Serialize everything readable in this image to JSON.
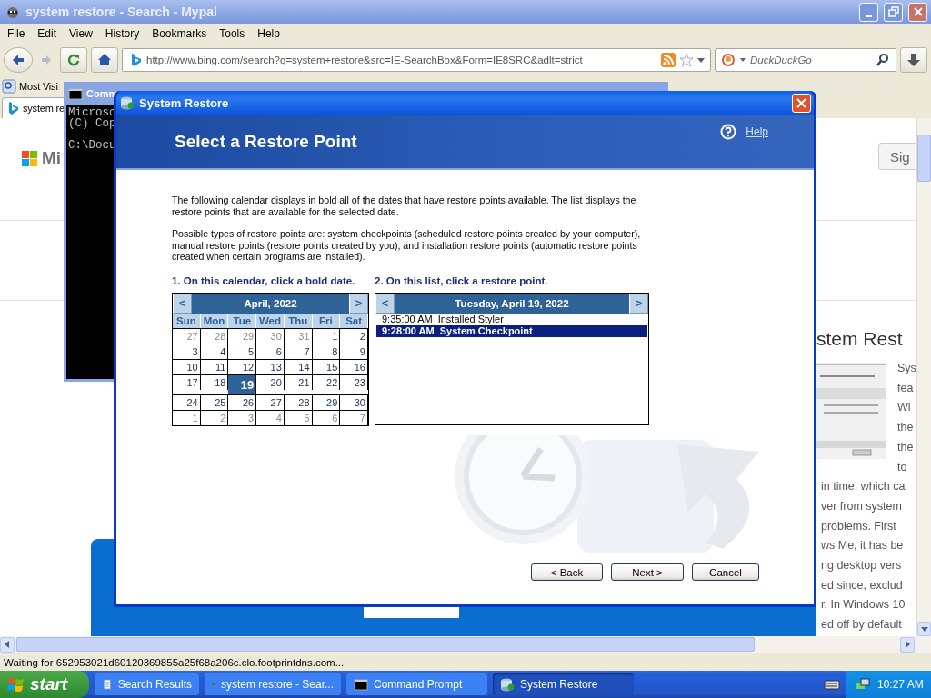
{
  "browser": {
    "title": "system restore - Search - Mypal",
    "menu": [
      "File",
      "Edit",
      "View",
      "History",
      "Bookmarks",
      "Tools",
      "Help"
    ],
    "url": "http://www.bing.com/search?q=system+restore&src=IE-SearchBox&Form=IE8SRC&adlt=strict",
    "search_placeholder": "DuckDuckGo",
    "bookmarks": [
      "Most Visi"
    ],
    "tabs": [
      {
        "label": "system re",
        "selected": true
      }
    ],
    "page": {
      "logo_text": "Mi",
      "sign_in": "Sig",
      "heading": "stem Rest",
      "side_lines": [
        "Sys",
        "fea",
        "Wi",
        "the",
        "the",
        "to"
      ],
      "lines": [
        "in time, which ca",
        "ver from system",
        "problems. First",
        "ws Me, it has be",
        "ng desktop vers",
        "ed since, exclud",
        "r. In Windows 10",
        "ed off by default"
      ]
    },
    "status": "Waiting for 652953021d60120369855a25f68a206c.clo.footprintdns.com..."
  },
  "console": {
    "title": "Comm",
    "lines": [
      "Microsc",
      "(C) Cop"
    ],
    "prompt": "C:\\Docu"
  },
  "dialog": {
    "title": "System Restore",
    "heading": "Select a Restore Point",
    "help": "Help",
    "paragraphs": [
      "The following calendar displays in bold all of the dates that have restore points available. The list displays the restore points that are available for the selected date.",
      "Possible types of restore points are: system checkpoints (scheduled restore points created by your computer), manual restore points (restore points created by you), and installation restore points (automatic restore points created when certain programs are installed)."
    ],
    "step1": "1. On this calendar, click a bold date.",
    "step2": "2. On this list, click a restore point.",
    "calendar": {
      "prev": "<",
      "next": ">",
      "month": "April, 2022",
      "weekdays": [
        "Sun",
        "Mon",
        "Tue",
        "Wed",
        "Thu",
        "Fri",
        "Sat"
      ],
      "weeks": [
        [
          {
            "day": "27",
            "other_month": true,
            "selected": false
          },
          {
            "day": "28",
            "other_month": true,
            "selected": false
          },
          {
            "day": "29",
            "other_month": true,
            "selected": false
          },
          {
            "day": "30",
            "other_month": true,
            "selected": false
          },
          {
            "day": "31",
            "other_month": true,
            "selected": false
          },
          {
            "day": "1",
            "other_month": false,
            "selected": false
          },
          {
            "day": "2",
            "other_month": false,
            "selected": false
          }
        ],
        [
          {
            "day": "3",
            "other_month": false,
            "selected": false
          },
          {
            "day": "4",
            "other_month": false,
            "selected": false
          },
          {
            "day": "5",
            "other_month": false,
            "selected": false
          },
          {
            "day": "6",
            "other_month": false,
            "selected": false
          },
          {
            "day": "7",
            "other_month": false,
            "selected": false
          },
          {
            "day": "8",
            "other_month": false,
            "selected": false
          },
          {
            "day": "9",
            "other_month": false,
            "selected": false
          }
        ],
        [
          {
            "day": "10",
            "other_month": false,
            "selected": false
          },
          {
            "day": "11",
            "other_month": false,
            "selected": false
          },
          {
            "day": "12",
            "other_month": false,
            "selected": false
          },
          {
            "day": "13",
            "other_month": false,
            "selected": false
          },
          {
            "day": "14",
            "other_month": false,
            "selected": false
          },
          {
            "day": "15",
            "other_month": false,
            "selected": false
          },
          {
            "day": "16",
            "other_month": false,
            "selected": false
          }
        ],
        [
          {
            "day": "17",
            "other_month": false,
            "selected": false
          },
          {
            "day": "18",
            "other_month": false,
            "selected": false
          },
          {
            "day": "19",
            "other_month": false,
            "selected": true
          },
          {
            "day": "20",
            "other_month": false,
            "selected": false
          },
          {
            "day": "21",
            "other_month": false,
            "selected": false
          },
          {
            "day": "22",
            "other_month": false,
            "selected": false
          },
          {
            "day": "23",
            "other_month": false,
            "selected": false
          }
        ],
        [
          {
            "day": "24",
            "other_month": false,
            "selected": false
          },
          {
            "day": "25",
            "other_month": false,
            "selected": false
          },
          {
            "day": "26",
            "other_month": false,
            "selected": false
          },
          {
            "day": "27",
            "other_month": false,
            "selected": false
          },
          {
            "day": "28",
            "other_month": false,
            "selected": false
          },
          {
            "day": "29",
            "other_month": false,
            "selected": false
          },
          {
            "day": "30",
            "other_month": false,
            "selected": false
          }
        ],
        [
          {
            "day": "1",
            "other_month": true,
            "selected": false
          },
          {
            "day": "2",
            "other_month": true,
            "selected": false
          },
          {
            "day": "3",
            "other_month": true,
            "selected": false
          },
          {
            "day": "4",
            "other_month": true,
            "selected": false
          },
          {
            "day": "5",
            "other_month": true,
            "selected": false
          },
          {
            "day": "6",
            "other_month": true,
            "selected": false
          },
          {
            "day": "7",
            "other_month": true,
            "selected": false
          }
        ]
      ]
    },
    "day_list": {
      "prev": "<",
      "next": ">",
      "title": "Tuesday, April 19, 2022",
      "items": [
        {
          "time": "9:35:00 AM",
          "name": "Installed Styler",
          "selected": false
        },
        {
          "time": "9:28:00 AM",
          "name": "System Checkpoint",
          "selected": true
        }
      ]
    },
    "buttons": [
      "< Back",
      "Next >",
      "Cancel"
    ]
  },
  "taskbar": {
    "start": "start",
    "tasks": [
      {
        "kind": "document",
        "label": "Search Results",
        "selected": false
      },
      {
        "kind": "browser",
        "label": "system restore - Sear...",
        "selected": false
      },
      {
        "kind": "console",
        "label": "Command Prompt",
        "selected": false
      },
      {
        "kind": "restore",
        "label": "System Restore",
        "selected": true
      }
    ],
    "clock": "10:27 AM"
  }
}
